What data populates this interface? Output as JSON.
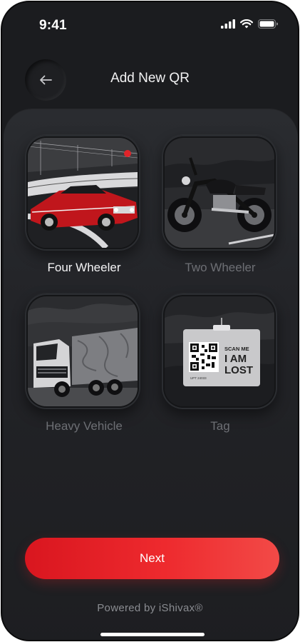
{
  "status_bar": {
    "time": "9:41"
  },
  "header": {
    "title": "Add New QR"
  },
  "categories": [
    {
      "label": "Four Wheeler",
      "selected": true
    },
    {
      "label": "Two Wheeler",
      "selected": false
    },
    {
      "label": "Heavy Vehicle",
      "selected": false
    },
    {
      "label": "Tag",
      "selected": false
    }
  ],
  "tag_image_text": {
    "line1": "SCAN ME",
    "line2": "I AM",
    "line3": "LOST",
    "code": "UPT 24033"
  },
  "next_button": {
    "label": "Next"
  },
  "footer": {
    "powered_by": "Powered by iShivax®"
  },
  "colors": {
    "accent": "#e8262b",
    "background": "#1b1c1f",
    "text_active": "#f4f4f5",
    "text_dim": "#6d6f74"
  }
}
